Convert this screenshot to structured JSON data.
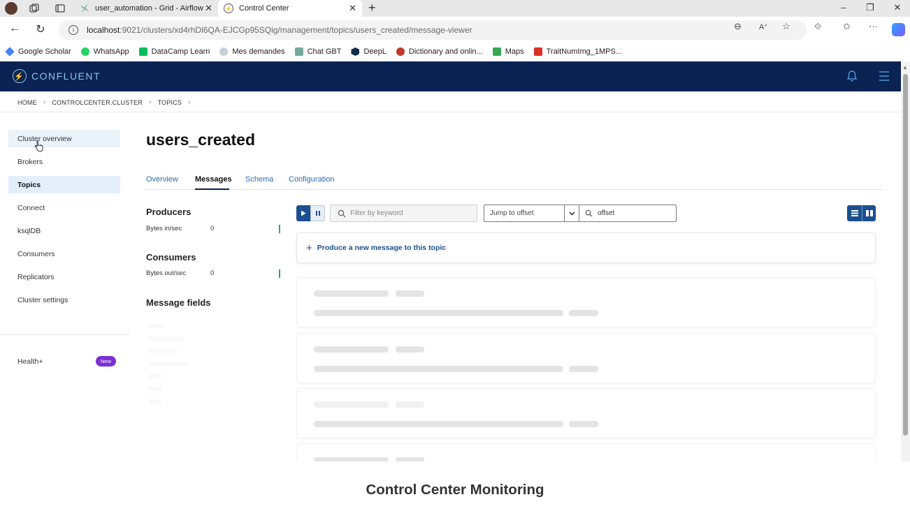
{
  "browser": {
    "tabs": [
      {
        "title": "user_automation - Grid - Airflow",
        "active": false
      },
      {
        "title": "Control Center",
        "active": true
      }
    ],
    "new_tab": "+",
    "url_host": "localhost",
    "url_path": ":9021/clusters/xd4rhDl6QA-EJCGp95SQig/management/topics/users_created/message-viewer",
    "bookmarks": [
      {
        "label": "Google Scholar",
        "icon": "google-scholar-icon",
        "color": "#4285f4"
      },
      {
        "label": "WhatsApp",
        "icon": "whatsapp-icon",
        "color": "#25d366"
      },
      {
        "label": "DataCamp Learn",
        "icon": "datacamp-icon",
        "color": "#03ef62"
      },
      {
        "label": "Mes demandes",
        "icon": "gear-icon",
        "color": "#9aa5b1"
      },
      {
        "label": "Chat GBT",
        "icon": "chatgpt-icon",
        "color": "#74aa9c"
      },
      {
        "label": "DeepL",
        "icon": "deepl-icon",
        "color": "#0f2b46"
      },
      {
        "label": "Dictionary and onlin...",
        "icon": "dictionary-icon",
        "color": "#c0392b"
      },
      {
        "label": "Maps",
        "icon": "maps-icon",
        "color": "#34a853"
      },
      {
        "label": "TraitNumImg_1MPS...",
        "icon": "pdf-icon",
        "color": "#d93025"
      }
    ]
  },
  "app": {
    "brand": "CONFLUENT",
    "breadcrumb": [
      "HOME",
      "CONTROLCENTER.CLUSTER",
      "TOPICS"
    ],
    "sidebar": {
      "items": [
        {
          "label": "Cluster overview",
          "state": "hover"
        },
        {
          "label": "Brokers",
          "state": ""
        },
        {
          "label": "Topics",
          "state": "active"
        },
        {
          "label": "Connect",
          "state": ""
        },
        {
          "label": "ksqlDB",
          "state": ""
        },
        {
          "label": "Consumers",
          "state": ""
        },
        {
          "label": "Replicators",
          "state": ""
        },
        {
          "label": "Cluster settings",
          "state": ""
        }
      ],
      "health_label": "Health+",
      "health_badge": "New"
    },
    "topic": {
      "title": "users_created",
      "tabs": [
        {
          "label": "Overview",
          "active": false
        },
        {
          "label": "Messages",
          "active": true
        },
        {
          "label": "Schema",
          "active": false
        },
        {
          "label": "Configuration",
          "active": false
        }
      ]
    },
    "metrics": {
      "producers_title": "Producers",
      "producers_label": "Bytes in/sec",
      "producers_value": "0",
      "consumers_title": "Consumers",
      "consumers_label": "Bytes out/sec",
      "consumers_value": "0",
      "fields_title": "Message fields"
    },
    "viewer": {
      "filter_placeholder": "Filter by keyword",
      "jump_select": "Jump to offset",
      "offset_value": "offset",
      "produce_label": "Produce a new message to this topic"
    }
  },
  "caption": "Control Center Monitoring"
}
